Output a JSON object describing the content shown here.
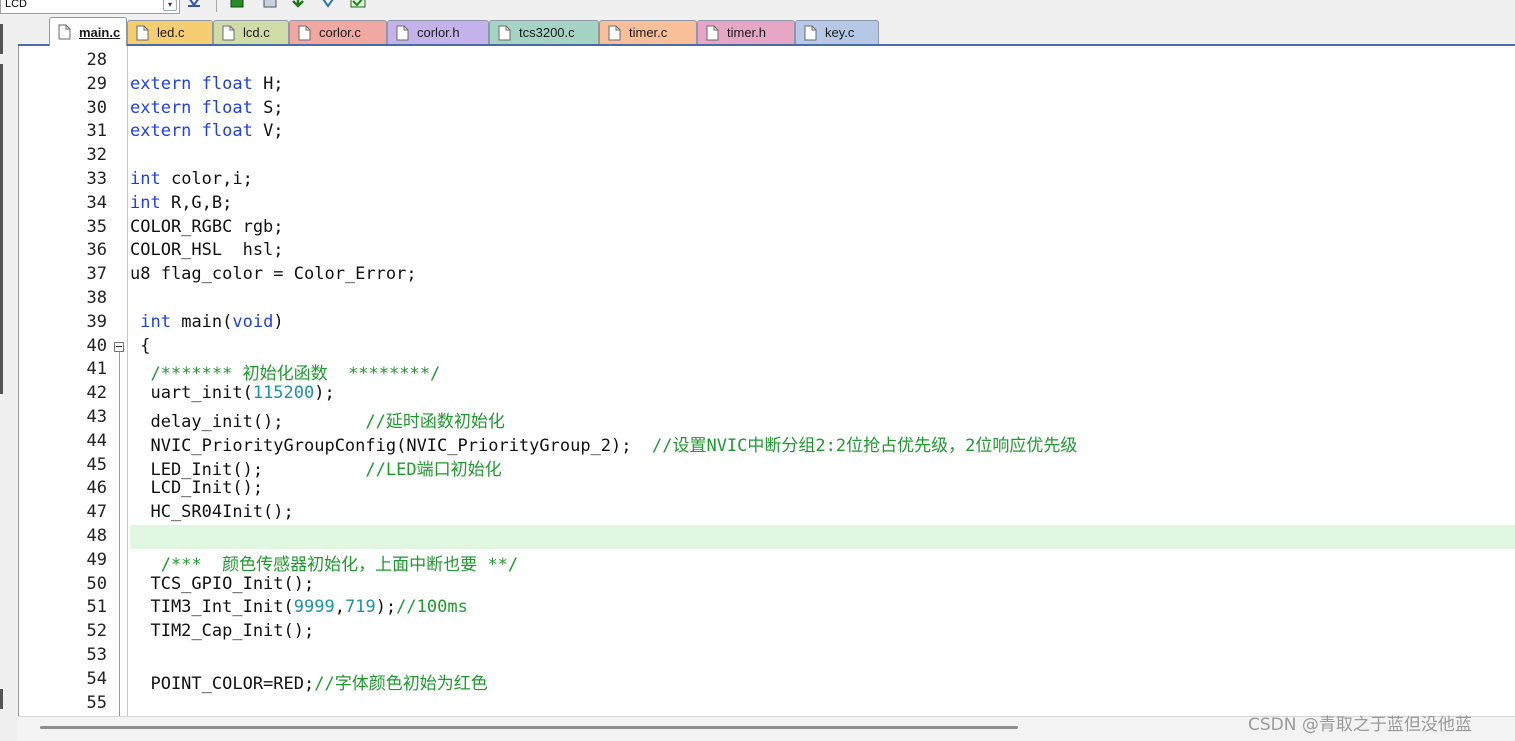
{
  "toolbar": {
    "target_combo_value": "LCD",
    "icons": [
      "dropdown-arrow-icon",
      "options-icon",
      "build-icon",
      "save-icon",
      "download-icon",
      "magic-wand-icon",
      "batch-build-icon"
    ]
  },
  "tabs": [
    {
      "label": "main.c",
      "color": "#ffffff",
      "active": true
    },
    {
      "label": "led.c",
      "color": "#f4ce70",
      "active": false
    },
    {
      "label": "lcd.c",
      "color": "#cfdca8",
      "active": false
    },
    {
      "label": "corlor.c",
      "color": "#f2a8a2",
      "active": false
    },
    {
      "label": "corlor.h",
      "color": "#c4b2ea",
      "active": false
    },
    {
      "label": "tcs3200.c",
      "color": "#a6d4c4",
      "active": false
    },
    {
      "label": "timer.c",
      "color": "#f8bf98",
      "active": false
    },
    {
      "label": "timer.h",
      "color": "#e6a6c6",
      "active": false
    },
    {
      "label": "key.c",
      "color": "#b6c8e6",
      "active": false
    }
  ],
  "editor": {
    "current_line": 48,
    "lines": [
      {
        "n": "28",
        "t": []
      },
      {
        "n": "29",
        "t": [
          [
            "kw",
            "extern float"
          ],
          [
            "p",
            " H;"
          ]
        ]
      },
      {
        "n": "30",
        "t": [
          [
            "kw",
            "extern float"
          ],
          [
            "p",
            " S;"
          ]
        ]
      },
      {
        "n": "31",
        "t": [
          [
            "kw",
            "extern float"
          ],
          [
            "p",
            " V;"
          ]
        ]
      },
      {
        "n": "32",
        "t": []
      },
      {
        "n": "33",
        "t": [
          [
            "kw",
            "int"
          ],
          [
            "p",
            " color,i;"
          ]
        ]
      },
      {
        "n": "34",
        "t": [
          [
            "kw",
            "int"
          ],
          [
            "p",
            " R,G,B;"
          ]
        ]
      },
      {
        "n": "35",
        "t": [
          [
            "p",
            "COLOR_RGBC rgb;"
          ]
        ]
      },
      {
        "n": "36",
        "t": [
          [
            "p",
            "COLOR_HSL  hsl;"
          ]
        ]
      },
      {
        "n": "37",
        "t": [
          [
            "p",
            "u8 flag_color = Color_Error;"
          ]
        ]
      },
      {
        "n": "38",
        "t": []
      },
      {
        "n": "39",
        "t": [
          [
            "p",
            " "
          ],
          [
            "kw",
            "int"
          ],
          [
            "p",
            " main("
          ],
          [
            "kw",
            "void"
          ],
          [
            "p",
            ")"
          ]
        ]
      },
      {
        "n": "40",
        "t": [
          [
            "p",
            " {"
          ]
        ],
        "fold": true
      },
      {
        "n": "41",
        "t": [
          [
            "p",
            "  "
          ],
          [
            "cm",
            "/******* 初始化函数  ********/"
          ]
        ]
      },
      {
        "n": "42",
        "t": [
          [
            "p",
            "  uart_init("
          ],
          [
            "num",
            "115200"
          ],
          [
            "p",
            ");"
          ]
        ]
      },
      {
        "n": "43",
        "t": [
          [
            "p",
            "  delay_init();        "
          ],
          [
            "cm",
            "//延时函数初始化"
          ]
        ]
      },
      {
        "n": "44",
        "t": [
          [
            "p",
            "  NVIC_PriorityGroupConfig(NVIC_PriorityGroup_2);  "
          ],
          [
            "cm",
            "//设置NVIC中断分组2:2位抢占优先级，2位响应优先级"
          ]
        ]
      },
      {
        "n": "45",
        "t": [
          [
            "p",
            "  LED_Init();          "
          ],
          [
            "cm",
            "//LED端口初始化"
          ]
        ]
      },
      {
        "n": "46",
        "t": [
          [
            "p",
            "  LCD_Init();"
          ]
        ]
      },
      {
        "n": "47",
        "t": [
          [
            "p",
            "  HC_SR04Init();"
          ]
        ]
      },
      {
        "n": "48",
        "t": []
      },
      {
        "n": "49",
        "t": [
          [
            "p",
            "   "
          ],
          [
            "cm",
            "/***  颜色传感器初始化，上面中断也要 **/"
          ]
        ]
      },
      {
        "n": "50",
        "t": [
          [
            "p",
            "  TCS_GPIO_Init();"
          ]
        ]
      },
      {
        "n": "51",
        "t": [
          [
            "p",
            "  TIM3_Int_Init("
          ],
          [
            "num",
            "9999"
          ],
          [
            "p",
            ","
          ],
          [
            "num",
            "719"
          ],
          [
            "p",
            ");"
          ],
          [
            "cm",
            "//100ms"
          ]
        ]
      },
      {
        "n": "52",
        "t": [
          [
            "p",
            "  TIM2_Cap_Init();"
          ]
        ]
      },
      {
        "n": "53",
        "t": []
      },
      {
        "n": "54",
        "t": [
          [
            "p",
            "  POINT_COLOR=RED;"
          ],
          [
            "cm",
            "//字体颜色初始为红色"
          ]
        ]
      },
      {
        "n": "55",
        "t": []
      }
    ]
  },
  "watermark": "CSDN @青取之于蓝但没他蓝"
}
